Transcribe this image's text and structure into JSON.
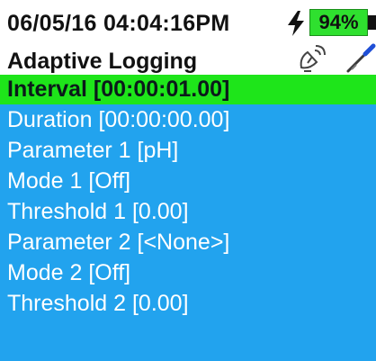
{
  "status_bar": {
    "datetime": "06/05/16 04:04:16PM",
    "battery_percent": "94%",
    "icons": [
      "charging-bolt-icon",
      "battery-icon",
      "satellite-icon",
      "probe-icon"
    ]
  },
  "screen": {
    "title": "Adaptive Logging"
  },
  "menu": {
    "items": [
      {
        "label": "Interval [00:00:01.00]",
        "selected": true
      },
      {
        "label": "Duration [00:00:00.00]",
        "selected": false
      },
      {
        "label": "Parameter 1 [pH]",
        "selected": false
      },
      {
        "label": "Mode 1 [Off]",
        "selected": false
      },
      {
        "label": "Threshold 1 [0.00]",
        "selected": false
      },
      {
        "label": "Parameter 2 [<None>]",
        "selected": false
      },
      {
        "label": "Mode 2 [Off]",
        "selected": false
      },
      {
        "label": "Threshold 2 [0.00]",
        "selected": false
      }
    ]
  },
  "colors": {
    "menu_background": "#22a3ee",
    "selected_background": "#1ee51a",
    "battery_fill": "#2fe02f",
    "menu_text": "#ffffff"
  }
}
